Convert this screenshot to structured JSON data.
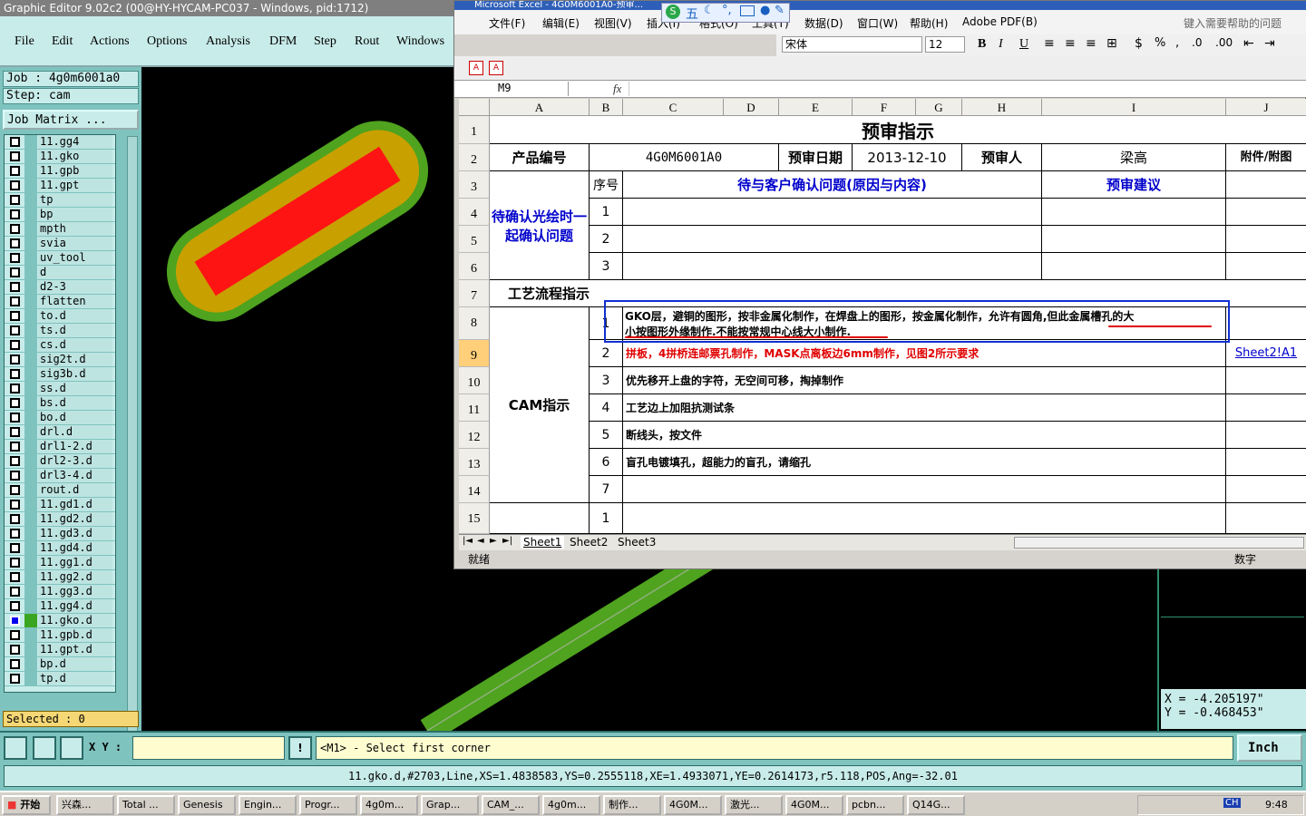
{
  "graphic_editor": {
    "title": "Graphic Editor 9.02c2 (00@HY-HYCAM-PC037 - Windows, pid:1712)",
    "menu": [
      "File",
      "Edit",
      "Actions",
      "Options",
      "Analysis",
      "DFM",
      "Step",
      "Rout",
      "Windows"
    ],
    "job_label": "Job : 4g0m6001a0",
    "step_label": "Step: cam",
    "job_matrix": "Job Matrix ...",
    "layers": [
      "11.gg4",
      "11.gko",
      "11.gpb",
      "11.gpt",
      "tp",
      "bp",
      "mpth",
      "svia",
      "uv_tool",
      "d",
      "d2-3",
      "flatten",
      "to.d",
      "ts.d",
      "cs.d",
      "sig2t.d",
      "sig3b.d",
      "ss.d",
      "bs.d",
      "bo.d",
      "drl.d",
      "drl1-2.d",
      "drl2-3.d",
      "drl3-4.d",
      "rout.d",
      "11.gd1.d",
      "11.gd2.d",
      "11.gd3.d",
      "11.gd4.d",
      "11.gg1.d",
      "11.gg2.d",
      "11.gg3.d",
      "11.gg4.d",
      "11.gko.d",
      "11.gpb.d",
      "11.gpt.d",
      "bp.d",
      "tp.d"
    ],
    "active_layer": "11.gko.d",
    "selected": "Selected : 0",
    "xy_label": "X Y :",
    "xy_value": "",
    "prompt": "<M1> - Select first corner",
    "unit": "Inch",
    "coord_x": "X = -4.205197\"",
    "coord_y": "Y = -0.468453\"",
    "status_line": "11.gko.d,#2703,Line,XS=1.4838583,YS=0.2555118,XE=1.4933071,YE=0.2614173,r5.118,POS,Ang=-32.01",
    "colors": {
      "panel": "#7fc3bf",
      "field": "#c8ecea",
      "pad_outer": "#4fa31f",
      "pad_mid": "#c8a000",
      "pad_inner": "#ff1414"
    }
  },
  "excel": {
    "title": "Microsoft Excel - 4G0M6001A0-预审...",
    "menu": [
      "文件(F)",
      "编辑(E)",
      "视图(V)",
      "插入(I)",
      "格式(O)",
      "工具(T)",
      "数据(D)",
      "窗口(W)",
      "帮助(H)",
      "Adobe PDF(B)"
    ],
    "help_search": "键入需要帮助的问题",
    "font_name": "宋体",
    "font_size": "12",
    "ime_label": "五",
    "name_box": "M9",
    "fx": "fx",
    "columns": [
      "A",
      "B",
      "C",
      "D",
      "E",
      "F",
      "G",
      "H",
      "I",
      "J"
    ],
    "rows": [
      "1",
      "2",
      "3",
      "4",
      "5",
      "6",
      "7",
      "8",
      "9",
      "10",
      "11",
      "12",
      "13",
      "14",
      "15"
    ],
    "sheet_title": "预审指示",
    "product_no_label": "产品编号",
    "product_no": "4G0M6001A0",
    "review_date_label": "预审日期",
    "review_date": "2013-12-10",
    "reviewer_label": "预审人",
    "reviewer": "梁高",
    "attachment_label": "附件/附图",
    "confirm_section": "待确认光绘时一起确认问题",
    "seq_label": "序号",
    "question_label": "待与客户确认问题(原因与内容)",
    "suggestion_label": "预审建议",
    "confirm_nums": [
      "1",
      "2",
      "3"
    ],
    "process_label": "工艺流程指示",
    "cam_label": "CAM指示",
    "cam_rows": [
      {
        "num": "1",
        "text_line1": "GKO层，避铜的图形，按非金属化制作，在焊盘上的图形，按金属化制作，允许有圆角,但此金属槽孔的大",
        "text_line2": "小按图形外缘制作.不能按常规中心线大小制作."
      },
      {
        "num": "2",
        "text": "拼板，4拼桥连邮票孔制作，MASK点离板边6mm制作，见图2所示要求",
        "link": "Sheet2!A1"
      },
      {
        "num": "3",
        "text": "优先移开上盘的字符，无空间可移，掏掉制作"
      },
      {
        "num": "4",
        "text": "工艺边上加阻抗测试条"
      },
      {
        "num": "5",
        "text": "断线头，按文件"
      },
      {
        "num": "6",
        "text": "盲孔电镀填孔，超能力的盲孔，请缩孔"
      },
      {
        "num": "7",
        "text": ""
      }
    ],
    "row15_num": "1",
    "sheets": [
      "Sheet1",
      "Sheet2",
      "Sheet3"
    ],
    "status_ready": "就绪",
    "status_num": "数字"
  },
  "taskbar": {
    "start": "开始",
    "tasks": [
      "兴森...",
      "Total ...",
      "Genesis",
      "Engin...",
      "Progr...",
      "4g0m...",
      "Grap...",
      "CAM_...",
      "4g0m...",
      "制作...",
      "4G0M...",
      "激光...",
      "4G0M...",
      "pcbn...",
      "Q14G..."
    ],
    "clock": "9:48",
    "tray_ch": "CH"
  }
}
